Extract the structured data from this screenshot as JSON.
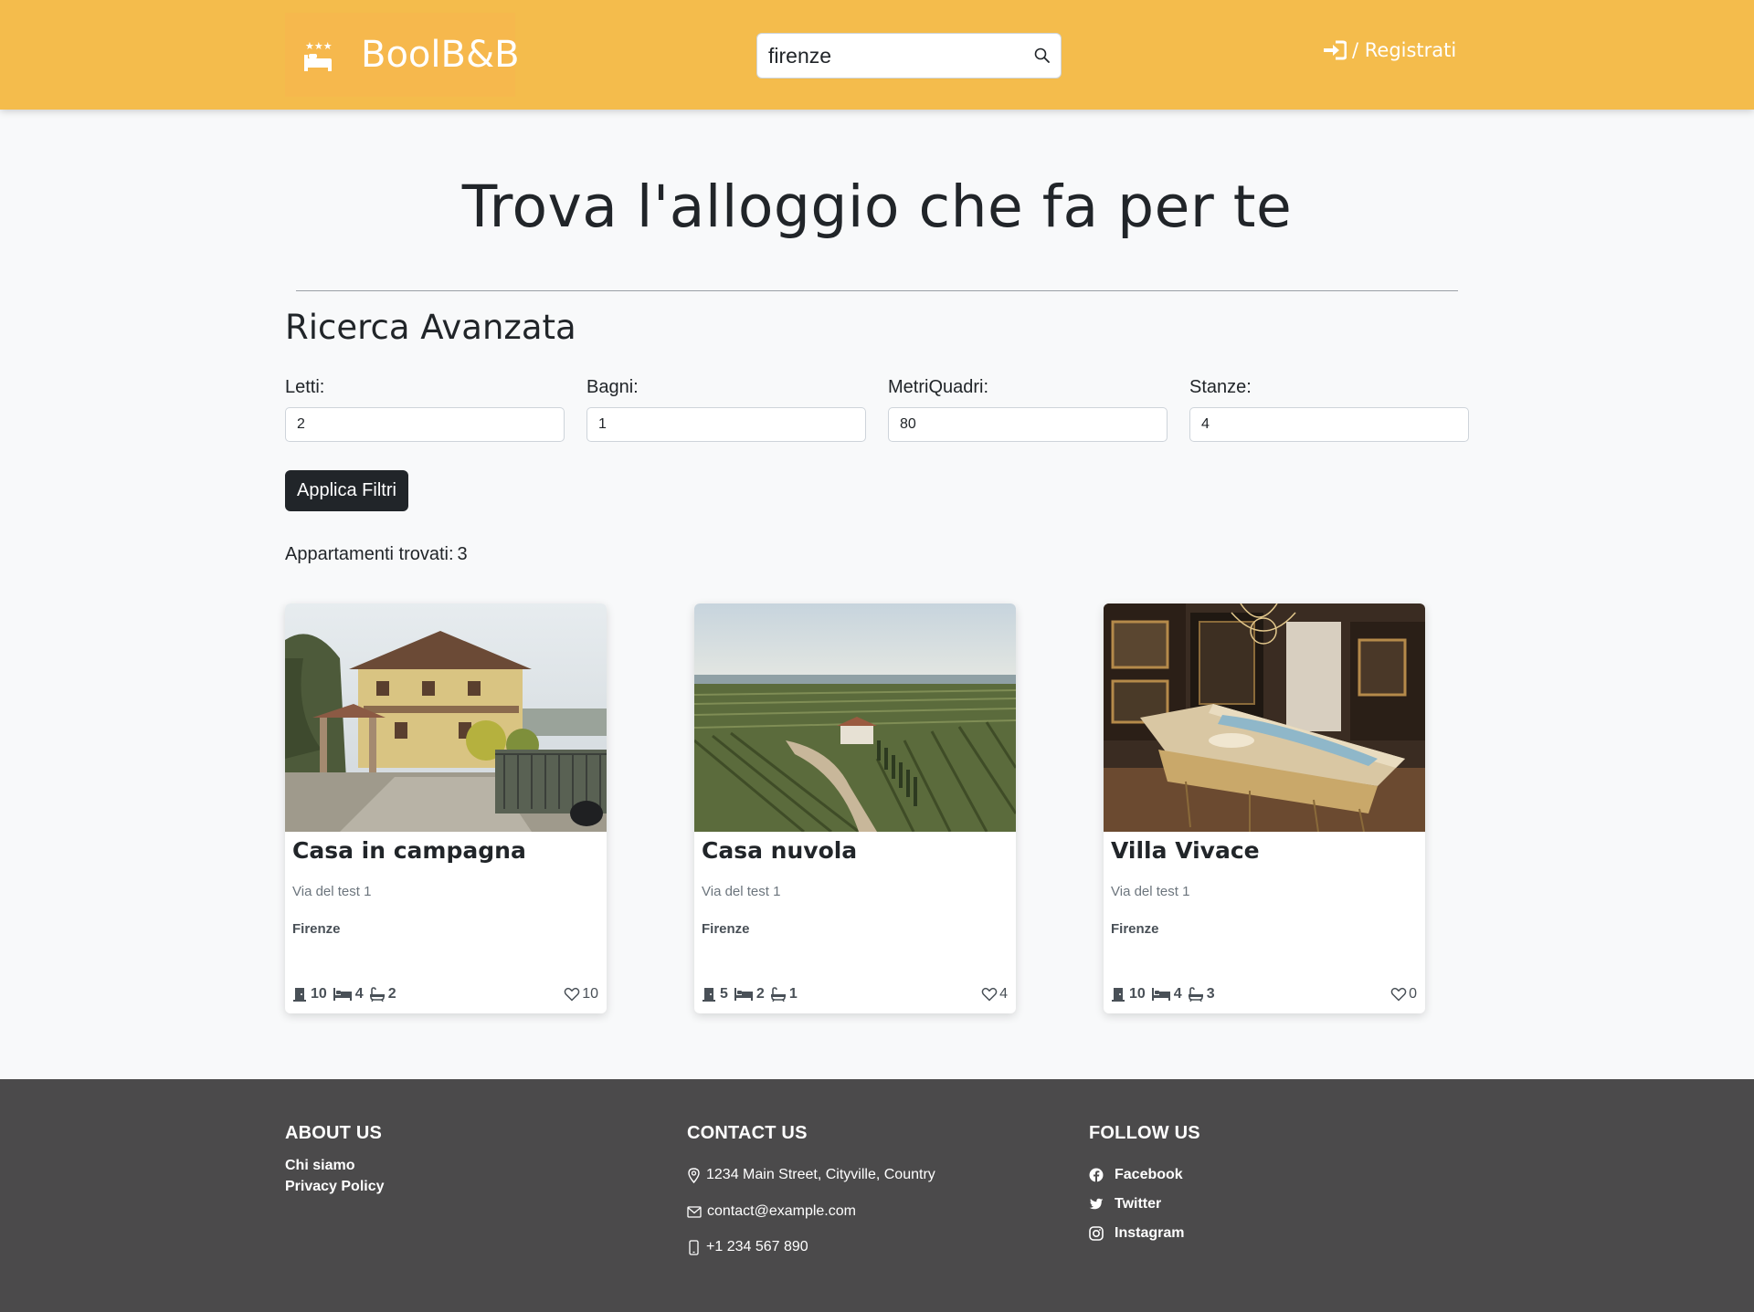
{
  "header": {
    "logo_text": "BoolB&B",
    "logo_icon": "hotel-bed-icon",
    "search": {
      "value": "firenze",
      "placeholder": ""
    },
    "search_icon": "search-icon",
    "register_label": "/ Registrati",
    "register_icon": "sign-in-icon",
    "colors": {
      "background": "#f4bc4c",
      "logo_bg": "#f6b84d"
    }
  },
  "main": {
    "title": "Trova l'alloggio che fa per te",
    "advanced_search": {
      "title": "Ricerca Avanzata",
      "filters": [
        {
          "label": "Letti:",
          "value": "2"
        },
        {
          "label": "Bagni:",
          "value": "1"
        },
        {
          "label": "MetriQuadri:",
          "value": "80"
        },
        {
          "label": "Stanze:",
          "value": "4"
        }
      ],
      "apply_label": "Applica Filtri"
    },
    "results": {
      "label": "Appartamenti trovati:",
      "count": "3"
    },
    "cards": [
      {
        "title": "Casa in campagna",
        "address": "Via del test 1",
        "city": "Firenze",
        "rooms": "10",
        "beds": "4",
        "bathrooms": "2",
        "likes": "10",
        "image": "yellow-country-house-photo"
      },
      {
        "title": "Casa nuvola",
        "address": "Via del test 1",
        "city": "Firenze",
        "rooms": "5",
        "beds": "2",
        "bathrooms": "1",
        "likes": "4",
        "image": "vineyard-aerial-photo"
      },
      {
        "title": "Villa Vivace",
        "address": "Via del test 1",
        "city": "Firenze",
        "rooms": "10",
        "beds": "4",
        "bathrooms": "3",
        "likes": "0",
        "image": "ornate-harpsichord-room-photo"
      }
    ]
  },
  "footer": {
    "about": {
      "heading": "ABOUT US",
      "links": [
        "Chi siamo",
        "Privacy Policy"
      ]
    },
    "contact": {
      "heading": "CONTACT US",
      "address": "1234 Main Street, Cityville, Country",
      "email": "contact@example.com",
      "phone": "+1 234 567 890"
    },
    "follow": {
      "heading": "FOLLOW US",
      "links": [
        "Facebook",
        "Twitter",
        "Instagram"
      ]
    },
    "colors": {
      "background": "#4b4a4b"
    }
  }
}
